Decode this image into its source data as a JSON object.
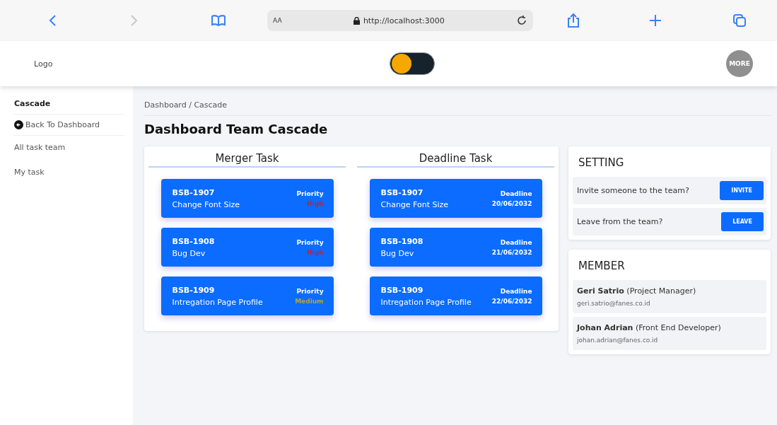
{
  "browser": {
    "text_size": "AA",
    "url": "http://localhost:3000"
  },
  "header": {
    "logo": "Logo",
    "toggle": {
      "on": false
    },
    "avatar": "MORE"
  },
  "sidebar": {
    "items": [
      {
        "kind": "heading",
        "label": "Cascade"
      },
      {
        "kind": "back",
        "label": "Back To Dashboard"
      },
      {
        "kind": "link",
        "label": "All task team"
      },
      {
        "kind": "link",
        "label": "My task"
      }
    ]
  },
  "breadcrumb": "Dashboard / Cascade",
  "title": "Dashboard Team Cascade",
  "columns": [
    {
      "title": "Merger Task",
      "cards": [
        {
          "code": "BSB-1907",
          "name": "Change Font Size",
          "label": "Priority",
          "value": "High",
          "color": "#b0264a"
        },
        {
          "code": "BSB-1908",
          "name": "Bug Dev",
          "label": "Priority",
          "value": "High",
          "color": "#b0264a"
        },
        {
          "code": "BSB-1909",
          "name": "Intregation Page Profile",
          "label": "Priority",
          "value": "Medium",
          "color": "#b8a33a"
        }
      ]
    },
    {
      "title": "Deadline Task",
      "cards": [
        {
          "code": "BSB-1907",
          "name": "Change Font Size",
          "label": "Deadline",
          "value": "20/06/2032",
          "color": "#ffffff"
        },
        {
          "code": "BSB-1908",
          "name": "Bug Dev",
          "label": "Deadline",
          "value": "21/06/2032",
          "color": "#ffffff"
        },
        {
          "code": "BSB-1909",
          "name": "Intregation Page Profile",
          "label": "Deadline",
          "value": "22/06/2032",
          "color": "#ffffff"
        }
      ]
    }
  ],
  "setting": {
    "title": "SETTING",
    "rows": [
      {
        "text": "Invite someone to the team?",
        "button": "INVITE"
      },
      {
        "text": "Leave from the team?",
        "button": "LEAVE"
      }
    ]
  },
  "member": {
    "title": "MEMBER",
    "rows": [
      {
        "name": "**Geri Satrio** (Project Manager)",
        "email": "geri.satrio@fanes.co.id"
      },
      {
        "name": "**Johan Adrian** (Front End Developer)",
        "email": "johan.adrian@fanes.co.id"
      }
    ]
  }
}
